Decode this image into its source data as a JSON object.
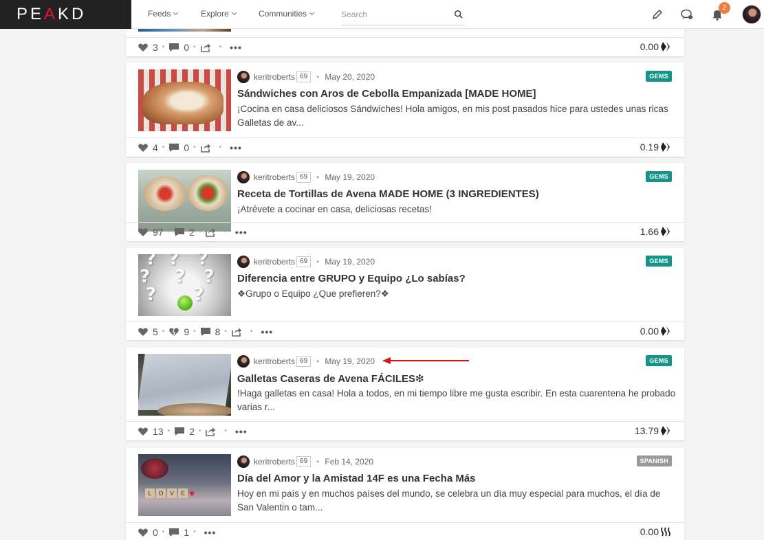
{
  "nav": {
    "logo_left": "PE",
    "logo_accent": "A",
    "logo_right": "KD",
    "feeds": "Feeds",
    "explore": "Explore",
    "communities": "Communities",
    "search_placeholder": "Search",
    "notification_count": "2"
  },
  "first_card_footer": {
    "likes": "3",
    "comments": "0",
    "payout": "0.00"
  },
  "posts": [
    {
      "author": "keritroberts",
      "rep": "69",
      "date": "May 20, 2020",
      "tag": "GEMS",
      "title": "Sándwiches con Aros de Cebolla Empanizada [MADE HOME]",
      "excerpt": "¡Cocina en casa deliciosos Sándwiches! Hola amigos, en mis post pasados hice para ustedes unas ricas Galletas de av...",
      "likes": "4",
      "comments": "0",
      "payout": "0.19"
    },
    {
      "author": "keritroberts",
      "rep": "69",
      "date": "May 19, 2020",
      "tag": "GEMS",
      "title": "Receta de Tortillas de Avena MADE HOME (3 INGREDIENTES)",
      "excerpt": "¡Atrévete a cocinar en casa, deliciosas recetas!",
      "likes": "97",
      "comments": "2",
      "payout": "1.66"
    },
    {
      "author": "keritroberts",
      "rep": "69",
      "date": "May 19, 2020",
      "tag": "GEMS",
      "title": "Diferencia entre GRUPO y Equipo ¿Lo sabías?",
      "excerpt": "❖Grupo o Equipo ¿Que prefieren?❖",
      "likes": "5",
      "downvotes": "9",
      "comments": "8",
      "payout": "0.00"
    },
    {
      "author": "keritroberts",
      "rep": "69",
      "date": "May 19, 2020",
      "tag": "GEMS",
      "title": "Galletas Caseras de Avena FÁCILES❇",
      "excerpt": "!Haga galletas en casa! Hola a todos, en mi tiempo libre me gusta escribir. En esta cuarentena he probado varias r...",
      "likes": "13",
      "comments": "2",
      "payout": "13.79"
    },
    {
      "author": "keritroberts",
      "rep": "69",
      "date": "Feb 14, 2020",
      "tag": "SPANISH",
      "title": "Día del Amor y la Amistad 14F es una Fecha Más",
      "excerpt": "Hoy en mi país y en muchos países del mundo, se celebra un día muy especial para muchos, el día de San Valentin o tam...",
      "likes": "0",
      "comments": "1",
      "payout": "0.00"
    }
  ]
}
